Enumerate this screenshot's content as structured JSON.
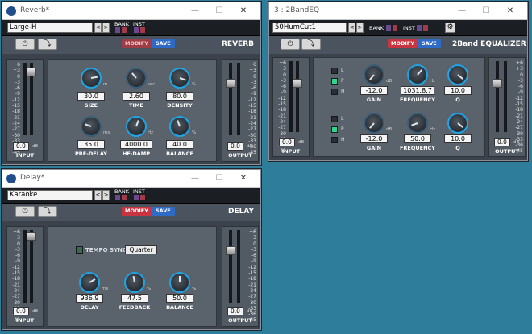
{
  "reverb": {
    "title": "Reverb*",
    "preset": "Large-H",
    "prev": "<",
    "next": ">",
    "bank": "BANK",
    "inst": "INST",
    "power": "⏻",
    "route": "⤵",
    "modify": "MODIFY",
    "save": "SAVE",
    "plugin": "REVERB",
    "scale": [
      "+6",
      "+3",
      "0",
      "-3",
      "-6",
      "-9",
      "-12",
      "-15",
      "-18",
      "-21",
      "-24",
      "-27",
      "-30",
      "-33",
      "-36",
      "-45"
    ],
    "input_value": "0.0",
    "input_label": "INPUT",
    "output_value": "0.0",
    "output_label": "OUTPUT",
    "db": "dB",
    "knobs": [
      {
        "value": "30.0",
        "label": "SIZE",
        "unit": "m"
      },
      {
        "value": "2.60",
        "label": "TIME",
        "unit": "sec"
      },
      {
        "value": "80.0",
        "label": "DENSITY",
        "unit": "%"
      },
      {
        "value": "35.0",
        "label": "PRE-DELAY",
        "unit": "ms"
      },
      {
        "value": "4000.0",
        "label": "HF-DAMP",
        "unit": "Hz"
      },
      {
        "value": "40.0",
        "label": "BALANCE",
        "unit": "%"
      }
    ]
  },
  "eq": {
    "title": "3 : 2BandEQ",
    "preset": "50HumCut1",
    "prev": "<",
    "next": ">",
    "bank": "BANK",
    "inst": "INST",
    "gear": "⚙",
    "power": "⏻",
    "route": "⤵",
    "modify": "MODIFY",
    "save": "SAVE",
    "plugin": "2Band EQUALIZER",
    "scale": [
      "+6",
      "+3",
      "0",
      "-3",
      "-6",
      "-9",
      "-12",
      "-15",
      "-18",
      "-21",
      "-24",
      "-27",
      "-30",
      "-33",
      "-36",
      "-45"
    ],
    "input_value": "0.0",
    "input_label": "INPUT",
    "output_value": "0.0",
    "output_label": "OUTPUT",
    "db": "dB",
    "lph": [
      "L",
      "P",
      "H"
    ],
    "bands": [
      {
        "gain": "-12.0",
        "gain_label": "GAIN",
        "gain_unit": "dB",
        "freq": "1031.8.7",
        "freq_label": "FREQUENCY",
        "freq_unit": "Hz",
        "q": "10.0",
        "q_label": "Q",
        "active": "P"
      },
      {
        "gain": "-12.0",
        "gain_label": "GAIN",
        "gain_unit": "dB",
        "freq": "50.0",
        "freq_label": "FREQUENCY",
        "freq_unit": "Hz",
        "q": "10.0",
        "q_label": "Q",
        "active": "P"
      }
    ]
  },
  "delay": {
    "title": "Delay*",
    "preset": "Karaoke",
    "prev": "<",
    "next": ">",
    "bank": "BANK",
    "inst": "INST",
    "power": "⏻",
    "route": "⤵",
    "modify": "MODIFY",
    "save": "SAVE",
    "plugin": "DELAY",
    "scale": [
      "+6",
      "+3",
      "0",
      "-3",
      "-6",
      "-9",
      "-12",
      "-15",
      "-18",
      "-21",
      "-24",
      "-27",
      "-30",
      "-33",
      "-36",
      "-45"
    ],
    "input_value": "0.0",
    "input_label": "INPUT",
    "output_value": "0.0",
    "output_label": "OUTPUT",
    "db": "dB",
    "tempo_sync": "TEMPO SYNC",
    "tempo_value": "Quarter",
    "knobs": [
      {
        "value": "936.9",
        "label": "DELAY",
        "unit": "ms"
      },
      {
        "value": "47.5",
        "label": "FEEDBACK",
        "unit": "%"
      },
      {
        "value": "50.0",
        "label": "BALANCE",
        "unit": "%"
      }
    ]
  },
  "window_buttons": {
    "min": "—",
    "max": "☐",
    "close": "✕"
  },
  "colors": {
    "desktop": "#2e7d9a",
    "panel": "#3b424c",
    "accent": "#1fa4e6",
    "modify": "#c8343f",
    "save": "#2d6bc7"
  }
}
